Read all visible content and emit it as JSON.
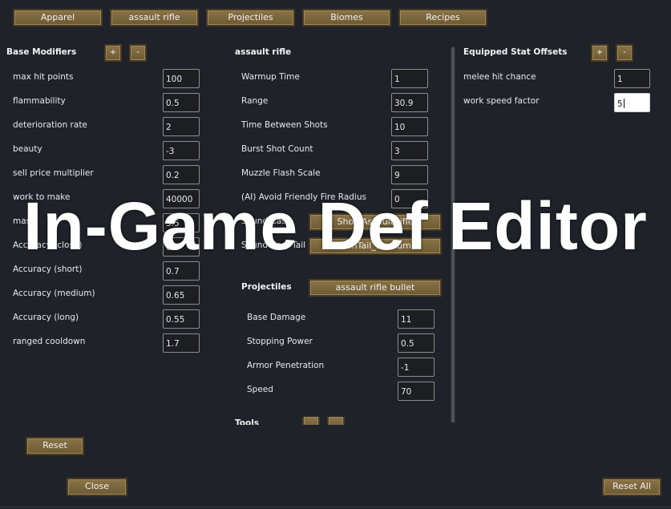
{
  "tabs": [
    "Apparel",
    "assault rifle",
    "Projectiles",
    "Biomes",
    "Recipes"
  ],
  "base_modifiers": {
    "title": "Base Modifiers",
    "plus": "+",
    "minus": "-",
    "rows": [
      {
        "label": "max hit points",
        "value": "100"
      },
      {
        "label": "flammability",
        "value": "0.5"
      },
      {
        "label": "deterioration rate",
        "value": "2"
      },
      {
        "label": "beauty",
        "value": "-3"
      },
      {
        "label": "sell price multiplier",
        "value": "0.2"
      },
      {
        "label": "work to make",
        "value": "40000"
      },
      {
        "label": "mass",
        "value": "3.5"
      },
      {
        "label": "Accuracy (close)",
        "value": "0.6"
      },
      {
        "label": "Accuracy (short)",
        "value": "0.7"
      },
      {
        "label": "Accuracy (medium)",
        "value": "0.65"
      },
      {
        "label": "Accuracy (long)",
        "value": "0.55"
      },
      {
        "label": "ranged cooldown",
        "value": "1.7"
      }
    ],
    "reset": "Reset"
  },
  "weapon": {
    "title": "assault rifle",
    "rows": [
      {
        "label": "Warmup Time",
        "value": "1"
      },
      {
        "label": "Range",
        "value": "30.9"
      },
      {
        "label": "Time Between Shots",
        "value": "10"
      },
      {
        "label": "Burst Shot Count",
        "value": "3"
      },
      {
        "label": "Muzzle Flash Scale",
        "value": "9"
      },
      {
        "label": "(AI) Avoid Friendly Fire Radius",
        "value": "0"
      }
    ],
    "sound_cast": {
      "label": "Sound Cast",
      "button": "Shot_AssaultRifle"
    },
    "sound_tail": {
      "label": "Sound Cast Tail",
      "button": "GunTail_Medium"
    },
    "projectiles": {
      "label": "Projectiles",
      "button": "assault rifle bullet",
      "rows": [
        {
          "label": "Base Damage",
          "value": "11"
        },
        {
          "label": "Stopping Power",
          "value": "0.5"
        },
        {
          "label": "Armor Penetration",
          "value": "-1"
        },
        {
          "label": "Speed",
          "value": "70"
        }
      ]
    },
    "tools": {
      "label": "Tools"
    }
  },
  "equipped_offsets": {
    "title": "Equipped Stat Offsets",
    "plus": "+",
    "minus": "-",
    "rows": [
      {
        "label": "melee hit chance",
        "value": "1"
      },
      {
        "label": "work speed factor",
        "value": "5"
      }
    ]
  },
  "footer": {
    "close": "Close",
    "reset_all": "Reset All"
  },
  "overlay_title": "In-Game Def Editor"
}
